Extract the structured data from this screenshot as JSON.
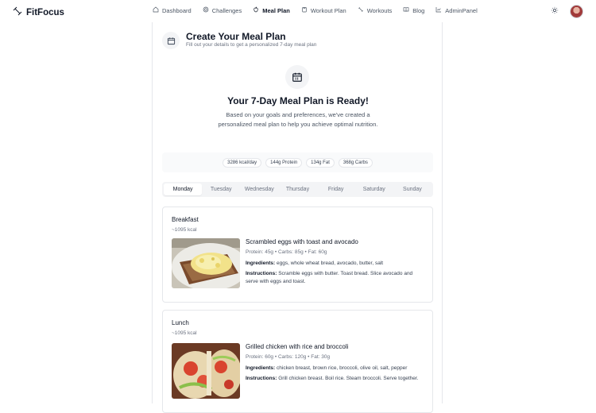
{
  "app": {
    "name": "FitFocus"
  },
  "nav": {
    "items": [
      {
        "label": "Dashboard",
        "icon": "home-icon"
      },
      {
        "label": "Challenges",
        "icon": "target-icon"
      },
      {
        "label": "Meal Plan",
        "icon": "apple-icon"
      },
      {
        "label": "Workout Plan",
        "icon": "clipboard-icon"
      },
      {
        "label": "Workouts",
        "icon": "dumbbell-icon"
      },
      {
        "label": "Blog",
        "icon": "book-icon"
      },
      {
        "label": "AdminPanel",
        "icon": "chart-icon"
      }
    ],
    "active": "Meal Plan"
  },
  "header": {
    "title": "Create Your Meal Plan",
    "subtitle": "Fill out your details to get a personalized 7-day meal plan"
  },
  "ready": {
    "title": "Your 7-Day Meal Plan is Ready!",
    "description": "Based on your goals and preferences, we've created a personalized meal plan to help you achieve optimal nutrition."
  },
  "macros": [
    "3286 kcal/day",
    "144g Protein",
    "134g Fat",
    "368g Carbs"
  ],
  "days": [
    "Monday",
    "Tuesday",
    "Wednesday",
    "Thursday",
    "Friday",
    "Saturday",
    "Sunday"
  ],
  "active_day": "Monday",
  "meals": [
    {
      "name": "Breakfast",
      "kcal": "~1095 kcal",
      "dish": "Scrambled eggs with toast and avocado",
      "nutrition": "Protein: 45g • Carbs: 85g • Fat: 60g",
      "ingredients_label": "Ingredients:",
      "ingredients": "eggs, whole wheat bread, avocado, butter, salt",
      "instructions_label": "Instructions:",
      "instructions": "Scramble eggs with butter. Toast bread. Slice avocado and serve with eggs and toast."
    },
    {
      "name": "Lunch",
      "kcal": "~1095 kcal",
      "dish": "Grilled chicken with rice and broccoli",
      "nutrition": "Protein: 60g • Carbs: 120g • Fat: 30g",
      "ingredients_label": "Ingredients:",
      "ingredients": "chicken breast, brown rice, broccoli, olive oil, salt, pepper",
      "instructions_label": "Instructions:",
      "instructions": "Grill chicken breast. Boil rice. Steam broccoli. Serve together."
    }
  ],
  "colors": {
    "accent": "#111827",
    "muted": "#6b7280",
    "border": "#e5e7eb",
    "panel": "#f9fafb"
  }
}
